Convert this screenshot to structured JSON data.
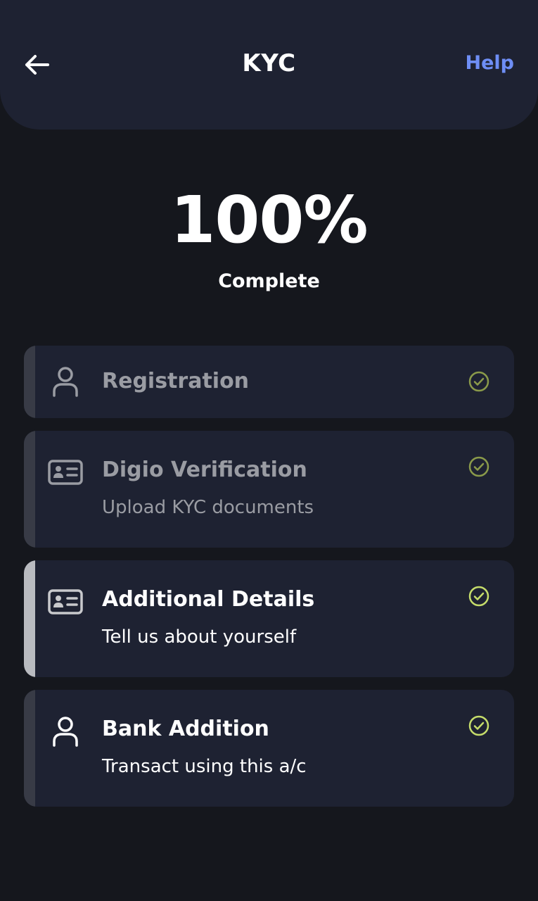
{
  "header": {
    "title": "KYC",
    "help_label": "Help",
    "help_color": "#6e8ef5"
  },
  "progress": {
    "value": "100%",
    "label": "Complete"
  },
  "steps": [
    {
      "title": "Registration",
      "subtitle": "",
      "icon": "user-icon",
      "state": "done"
    },
    {
      "title": "Digio Verification",
      "subtitle": "Upload KYC documents",
      "icon": "id-card-icon",
      "state": "done"
    },
    {
      "title": "Additional Details",
      "subtitle": "Tell us about yourself",
      "icon": "id-card-icon",
      "state": "done"
    },
    {
      "title": "Bank Addition",
      "subtitle": "Transact using this a/c",
      "icon": "user-icon",
      "state": "done"
    }
  ],
  "colors": {
    "check_muted": "#8a9a4a",
    "check_active": "#c5dc6a"
  }
}
